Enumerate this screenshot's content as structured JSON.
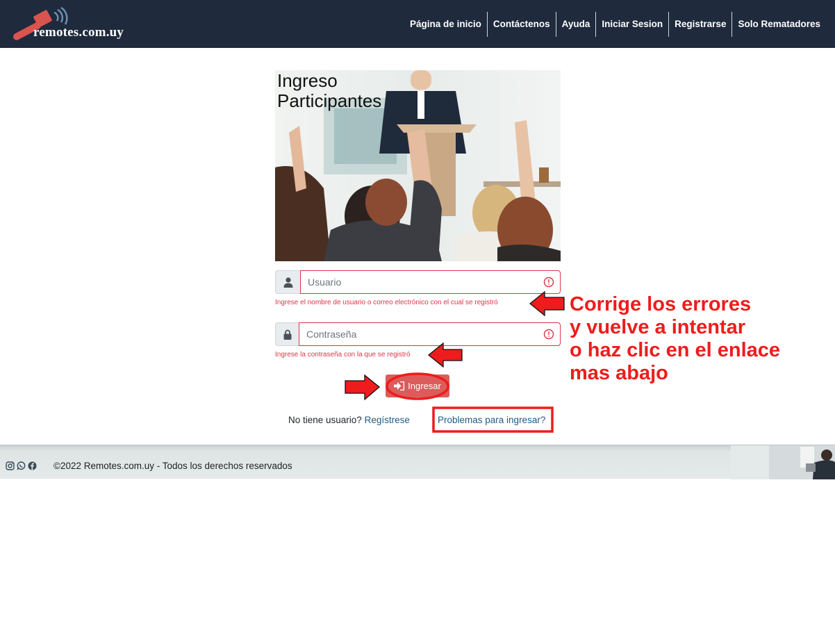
{
  "header": {
    "logo_text": "remotes.com.uy",
    "nav": [
      {
        "label": "Página de inicio"
      },
      {
        "label": "Contáctenos"
      },
      {
        "label": "Ayuda"
      },
      {
        "label": "Iniciar Sesion"
      },
      {
        "label": "Registrarse"
      },
      {
        "label": "Solo Rematadores"
      }
    ]
  },
  "hero": {
    "title_line1": "Ingreso",
    "title_line2": "Participantes"
  },
  "form": {
    "username": {
      "placeholder": "Usuario",
      "value": "",
      "error": "Ingrese el nombre de usuario o correo electrónico con el cual se registró",
      "icon": "user-icon"
    },
    "password": {
      "placeholder": "Contraseña",
      "value": "",
      "error": "Ingrese la contraseña con la que se registró",
      "icon": "lock-icon"
    },
    "submit_label": "Ingresar",
    "submit_icon": "sign-in-icon",
    "no_user_text": "No tiene usuario?",
    "register_link": "Regístrese",
    "problems_link": "Problemas para ingresar?"
  },
  "annotation": {
    "lines": [
      "Corrige los errores",
      "y vuelve a intentar",
      "o haz clic en el enlace",
      "mas abajo"
    ],
    "color": "#ee1c1c"
  },
  "footer": {
    "icons": [
      "instagram-icon",
      "whatsapp-icon",
      "facebook-icon"
    ],
    "copyright": "©2022 Remotes.com.uy - Todos los derechos reservados"
  },
  "colors": {
    "navbar": "#1f2a3c",
    "error": "#dc3545",
    "button": "#db5c5b",
    "link": "#1f5a86"
  }
}
